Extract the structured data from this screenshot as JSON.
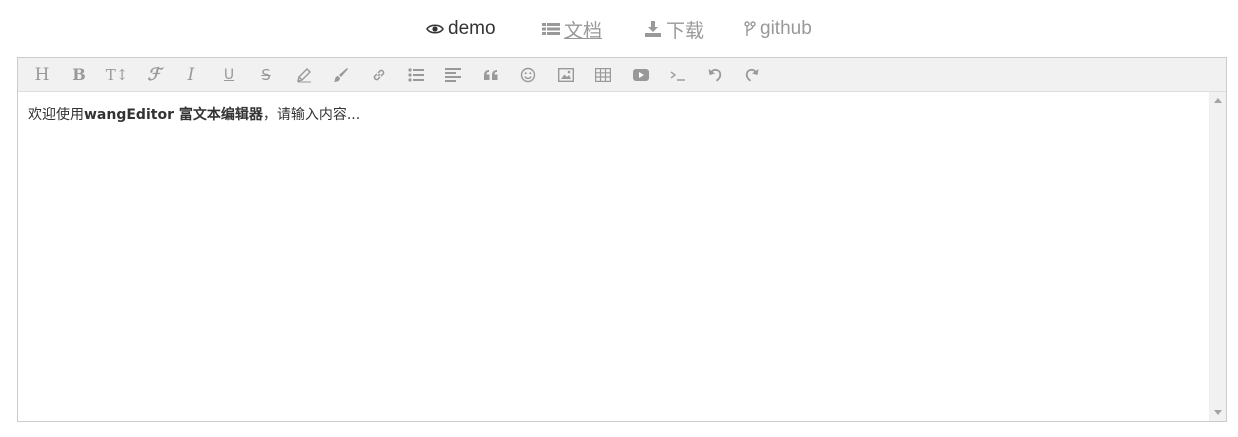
{
  "nav": {
    "demo": {
      "label": "demo",
      "icon": "eye-icon"
    },
    "docs": {
      "label": "文档",
      "icon": "list-icon"
    },
    "download": {
      "label": "下载",
      "icon": "download-icon"
    },
    "github": {
      "label": "github",
      "icon": "fork-icon"
    }
  },
  "toolbar": {
    "heading": "H",
    "bold": "B",
    "font_size": "T↕",
    "font_name": "ℱ",
    "italic": "I",
    "underline": "U",
    "strikethrough": "S"
  },
  "editor": {
    "content_prefix": "欢迎使用",
    "content_bold": "wangEditor 富文本编辑器",
    "content_suffix": "，请输入内容..."
  },
  "colors": {
    "toolbar_bg": "#f1f1f1",
    "icon_gray": "#999999",
    "active_text": "#333333",
    "border": "#cccccc"
  }
}
